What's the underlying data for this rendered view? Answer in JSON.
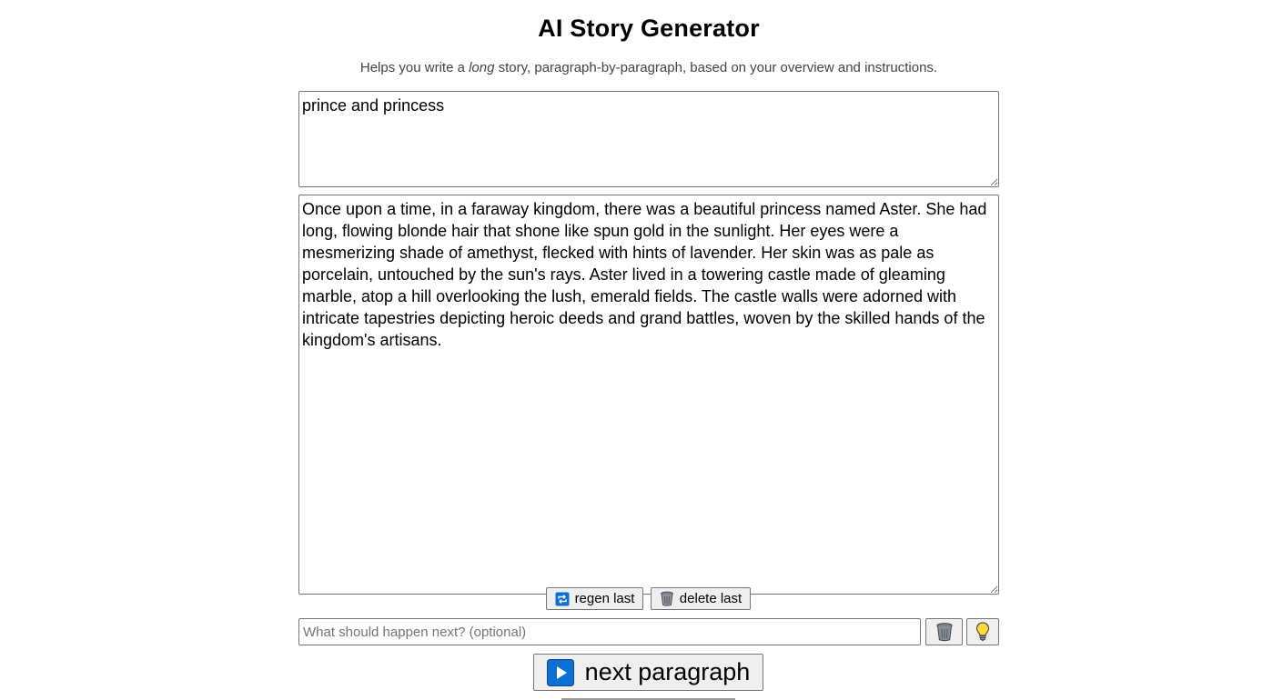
{
  "header": {
    "title": "AI Story Generator",
    "subtitle_before": "Helps you write a ",
    "subtitle_em": "long",
    "subtitle_after": " story, paragraph-by-paragraph, based on your overview and instructions."
  },
  "overview": {
    "value": "prince and princess"
  },
  "story": {
    "value": "Once upon a time, in a faraway kingdom, there was a beautiful princess named Aster. She had long, flowing blonde hair that shone like spun gold in the sunlight. Her eyes were a mesmerizing shade of amethyst, flecked with hints of lavender. Her skin was as pale as porcelain, untouched by the sun's rays. Aster lived in a towering castle made of gleaming marble, atop a hill overlooking the lush, emerald fields. The castle walls were adorned with intricate tapestries depicting heroic deeds and grand battles, woven by the skilled hands of the kingdom's artisans."
  },
  "controls": {
    "regen_label": "regen last",
    "delete_label": "delete last",
    "instruction_placeholder": "What should happen next? (optional)",
    "instruction_value": "",
    "next_label": "next paragraph"
  },
  "icons": {
    "regen": "repeat-icon",
    "delete": "wastebasket-icon",
    "clear": "wastebasket-icon",
    "idea": "light-bulb-icon",
    "next": "play-icon"
  },
  "colors": {
    "accent_blue": "#0b6fd6",
    "bulb_yellow": "#ffd83b"
  }
}
